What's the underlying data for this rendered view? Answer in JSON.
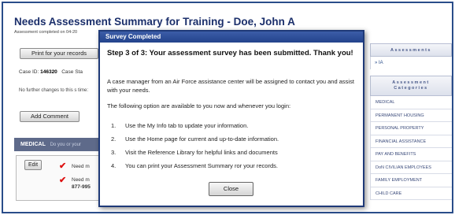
{
  "page": {
    "title": "Needs Assessment Summary for Training - Doe, John A",
    "subtitle": "Assessment completed on 04-20",
    "print_button": "Print for your records",
    "case_id_label": "Case ID:",
    "case_id_value": "146320",
    "case_status_label": "Case Sta",
    "no_changes_text": "No further changes to this s time:",
    "add_comment_button": "Add Comment",
    "medical_section_label": "MEDICAL",
    "medical_section_hint": "Do you or your",
    "edit_button": "Edit",
    "need_item_1": "Need m",
    "need_item_2_line1": "Need m",
    "need_item_2_line2": "877-995"
  },
  "sidebar": {
    "assessments_header": "Assessments",
    "assessment_item": "» IA",
    "categories_header_line1": "Assessment",
    "categories_header_line2": "Categories",
    "categories": [
      "MEDICAL",
      "PERMANENT HOUSING",
      "PERSONAL PROPERTY",
      "FINANCIAL ASSISTANCE",
      "PAY AND BENEFITS",
      "DoN CIVILIAN EMPLOYEES",
      "FAMILY EMPLOYMENT",
      "CHILD CARE"
    ]
  },
  "modal": {
    "title": "Survey Completed",
    "heading": "Step 3 of 3: Your assessment survey has been submitted. Thank you!",
    "paragraph1": "A case manager from an Air Force assistance center will be assigned to contact you and assist with your needs.",
    "paragraph2": "The following option are available to you now and whenever you login:",
    "options": [
      {
        "num": "1.",
        "text": "Use the My Info tab to update your information."
      },
      {
        "num": "2.",
        "text": "Use the Home page for current and up-to-date information."
      },
      {
        "num": "3.",
        "text": "Visit the Reference Library for helpful links and documents"
      },
      {
        "num": "4.",
        "text": "You can print your Assessment Summary ror your records."
      }
    ],
    "close_button": "Close"
  },
  "colors": {
    "accent": "#1f3a78",
    "title_bar": "#2f4f9a",
    "check": "#dd1111"
  }
}
